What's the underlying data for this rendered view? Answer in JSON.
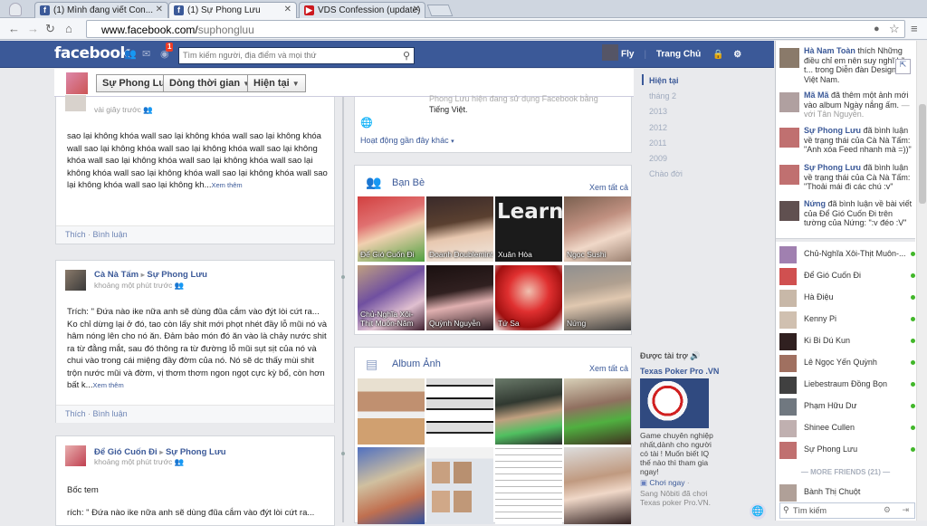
{
  "browser": {
    "tabs": [
      {
        "label": "(1) Mình đang viết Con...",
        "active": false,
        "icon": "facebook-icon"
      },
      {
        "label": "(1) Sự Phong Lưu",
        "active": true,
        "icon": "facebook-icon"
      },
      {
        "label": "VDS Confession (update)",
        "active": false,
        "icon": "youtube-icon"
      }
    ],
    "url_host": "www.facebook.com/",
    "url_path": "suphongluu"
  },
  "header": {
    "logo": "facebook",
    "notification_count": "1",
    "search_placeholder": "Tìm kiếm người, địa điểm và mọi thứ",
    "user_name": "Fly",
    "home_label": "Trang Chủ"
  },
  "timeline_bar": {
    "name": "Sự Phong Lưu",
    "timeline": "Dòng thời gian",
    "now": "Hiện tại"
  },
  "post1": {
    "time": "vài giây trước",
    "text": "sao lại không khóa wall sao lại không khóa wall sao lại không khóa wall sao lại không khóa wall sao lại không khóa wall sao lại không khóa wall sao lại không khóa wall sao lại không khóa wall sao lại không khóa wall sao lại không khóa wall sao lại không khóa wall sao lại không khóa wall sao lại không kh...",
    "see_more": "Xem thêm",
    "like": "Thích",
    "comment": "Bình luận"
  },
  "post2": {
    "author": "Cà Nà Tấm",
    "target": "Sự Phong Lưu",
    "time": "khoảng một phút trước",
    "text": "Trích: \" Đứa nào ike nữa anh sẽ dùng đũa cắm vào đýt lòi cứt ra... Ko chỉ dừng lại ở đó, tao còn lấy shit mới phọt nhét đầy lỗ mũi nó và hâm nóng lên cho nó ăn. Đảm bảo món đó ăn vào là chảy nước shit ra từ đằng mắt, sau đó thông ra từ đường lỗ mũi sụt sịt của nó và chui vào trong cái miệng đầy đờm của nó. Nó sẽ dc thấy mùi shit trộn nước mũi và đờm, vị thơm thơm ngon ngọt cực kỳ bổ, còn hơn bất k...",
    "see_more": "Xem thêm",
    "like": "Thích",
    "comment": "Bình luận"
  },
  "post3": {
    "author": "Để Gió Cuốn Đi",
    "target": "Sự Phong Lưu",
    "time": "khoảng một phút trước",
    "text1": "Bốc tem",
    "text2": "rích: \" Đứa nào ike nữa anh sẽ dùng đũa cắm vào đýt lòi cứt ra..."
  },
  "about_box": {
    "line1": "Phong Lưu hiện đang sử dụng Facebook bằng",
    "line2": "Tiếng Việt.",
    "recent": "Hoạt động gần đây khác"
  },
  "friends_box": {
    "title": "Bạn Bè",
    "see_all": "Xem tất cả",
    "items": [
      "Để Gió Cuốn Đi",
      "Doanh Doublemint",
      "Xuân Hòa",
      "Ngọc Sushi",
      "Chủ-Nghĩa Xôi-Thịt Muốn-Năm",
      "Quỳnh Nguyễn",
      "Tứ Sa",
      "Nứng"
    ],
    "learn_overlay": "Learn"
  },
  "album_box": {
    "title": "Album Ảnh",
    "see_all": "Xem tất cả"
  },
  "years": [
    "Hiện tại",
    "tháng 2",
    "2013",
    "2012",
    "2011",
    "2009",
    "Chào đời"
  ],
  "ad": {
    "sponsored": "Được tài trợ",
    "title": "Texas Poker Pro .VN",
    "body": "Game chuyên nghiệp nhất,dành cho người có tài ! Muốn biết IQ thế nào thì tham gia ngay!",
    "cta": "Chơi ngay",
    "social": "Sang Nôbiti đã chơi Texas poker Pro.VN."
  },
  "ticker": [
    {
      "name": "Hà Nam Toàn",
      "text": " thích Những điều chỉ em nên suy nghĩ kỹ t... trong Diễn đàn Designer Việt Nam."
    },
    {
      "name": "Mã Mã",
      "text": " đã thêm một ảnh mới vào album Ngày nắng ấm.",
      "sub": " — với Tân Nguyễn."
    },
    {
      "name": "Sự Phong Lưu",
      "text": " đã bình luận về trạng thái của Cà Nà Tấm: \"Anh xóa Feed nhanh mà =))\""
    },
    {
      "name": "Sự Phong Lưu",
      "text": " đã bình luận về trạng thái của Cà Nà Tấm: \"Thoải mái đi các chú :v\""
    },
    {
      "name": "Nứng",
      "text": " đã bình luận về bài viết của Để Gió Cuốn Đi trên tường của Nứng: \":v đéo :V\""
    }
  ],
  "chat": {
    "online": [
      "Chủ-Nghĩa Xôi-Thịt Muôn-...",
      "Để Gió Cuốn Đi",
      "Hà Điệu",
      "Kenny Pi",
      "Ki Bi Dú Kun",
      "Lê Ngọc Yến Quỳnh",
      "Liebestraum Đồng Bọn",
      "Phạm Hữu Dư",
      "Shinee Cullen",
      "Sự Phong Lưu"
    ],
    "more_friends": "MORE FRIENDS (21)",
    "offline": [
      "Bành Thị Chuột"
    ],
    "search_placeholder": "Tìm kiếm"
  },
  "colors": {
    "brand": "#3b5998",
    "online": "#42b72a"
  }
}
